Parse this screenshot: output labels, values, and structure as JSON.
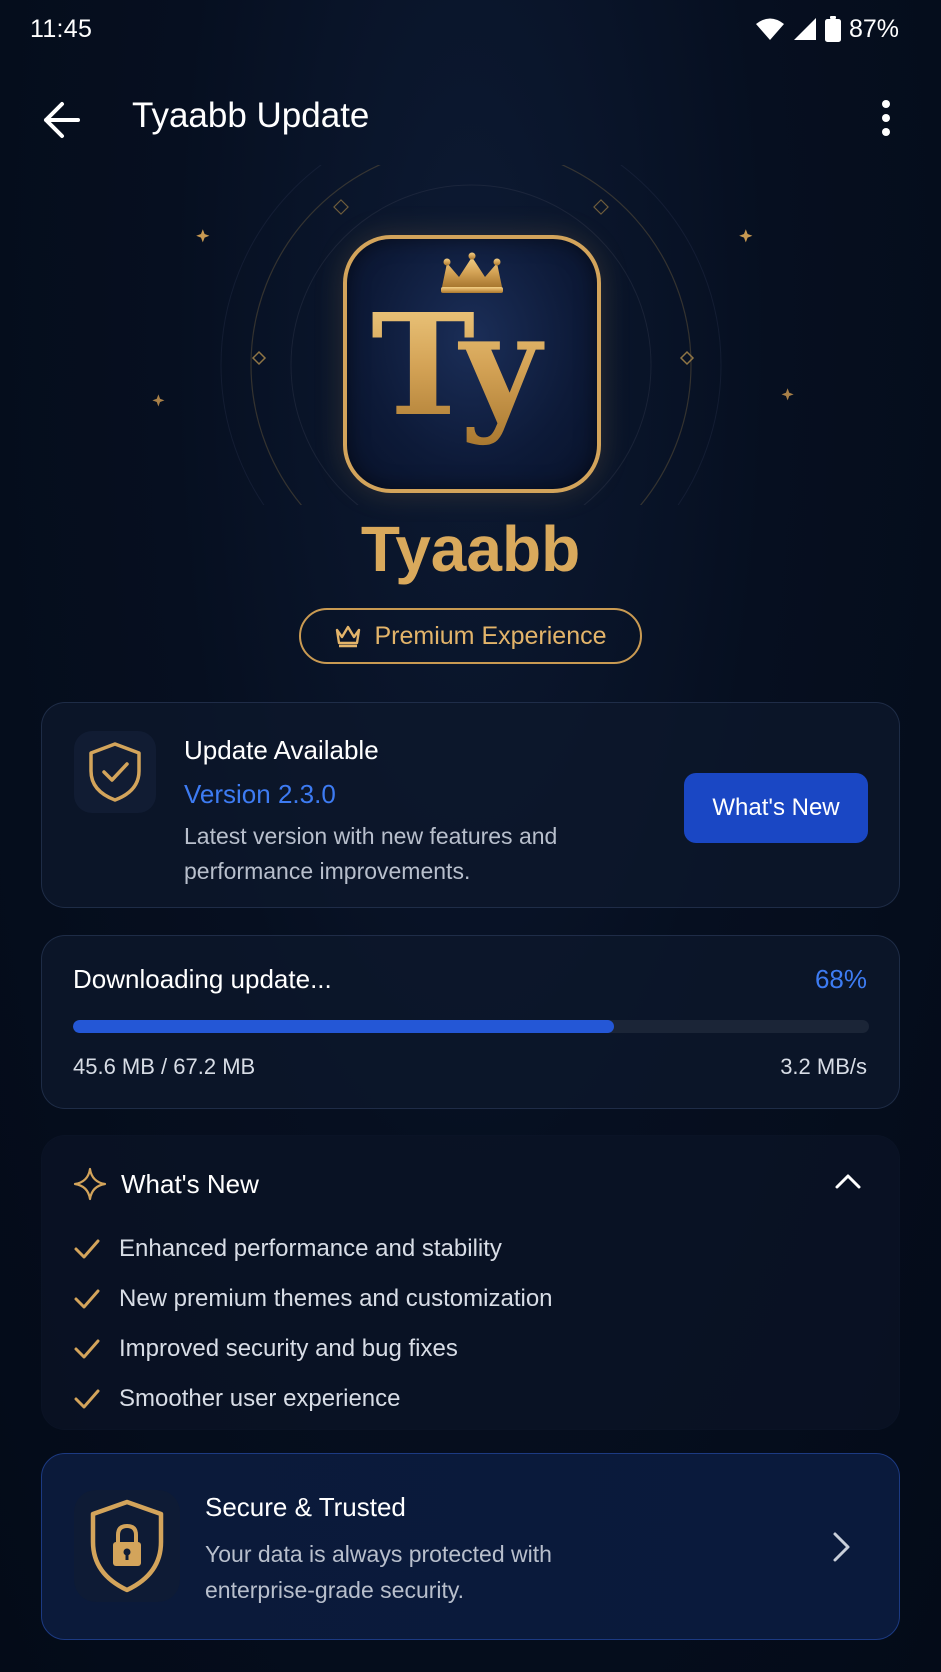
{
  "status_bar": {
    "time": "11:45",
    "battery": "87%"
  },
  "app_bar": {
    "title": "Tyaabb Update"
  },
  "hero": {
    "brand_name": "Tyaabb",
    "icon_letters": "Ty",
    "premium_label": "Premium Experience"
  },
  "update_card": {
    "title": "Update Available",
    "version": "Version 2.3.0",
    "description": "Latest version with new features and performance improvements.",
    "button_label": "What's New"
  },
  "download": {
    "title": "Downloading update...",
    "percent_label": "68%",
    "progress_fraction": 0.68,
    "size": "45.6 MB / 67.2 MB",
    "speed": "3.2 MB/s"
  },
  "whats_new": {
    "title": "What's New",
    "items": [
      "Enhanced performance and stability",
      "New premium themes and customization",
      "Improved security and bug fixes",
      "Smoother user experience"
    ]
  },
  "secure": {
    "title": "Secure & Trusted",
    "description": "Your data is always protected with enterprise-grade security."
  },
  "colors": {
    "gold": "#d9a95c",
    "accent_blue": "#3d7bf2",
    "button_blue": "#1a47c4",
    "background": "#050d1c"
  },
  "icons": [
    "back-arrow-icon",
    "more-vert-icon",
    "crown-icon",
    "shield-check-icon",
    "sparkle-icon",
    "chevron-up-icon",
    "check-icon",
    "shield-lock-icon",
    "chevron-right-icon",
    "wifi-icon",
    "signal-icon",
    "battery-icon"
  ]
}
